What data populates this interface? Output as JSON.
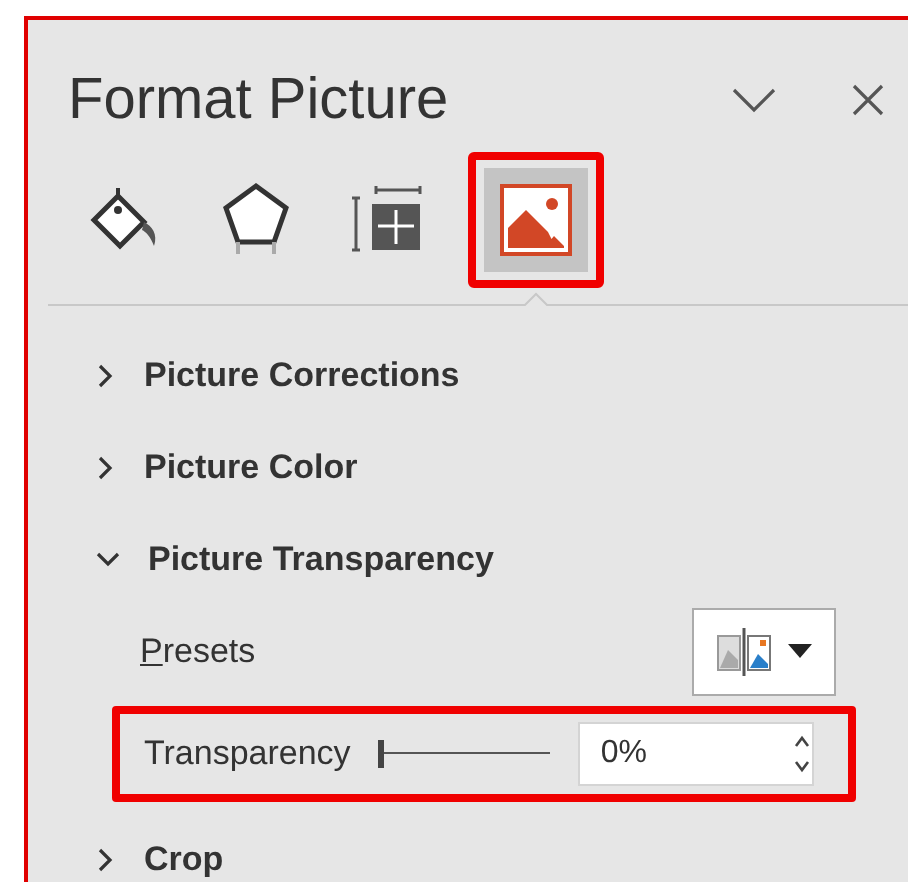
{
  "pane": {
    "title": "Format Picture",
    "highlighted": true
  },
  "tabs": [
    {
      "kind": "fill",
      "selected": false,
      "highlighted": false
    },
    {
      "kind": "shape",
      "selected": false,
      "highlighted": false
    },
    {
      "kind": "size",
      "selected": false,
      "highlighted": false
    },
    {
      "kind": "picture",
      "selected": true,
      "highlighted": true
    }
  ],
  "sections": [
    {
      "label": "Picture Corrections",
      "expanded": false
    },
    {
      "label": "Picture Color",
      "expanded": false
    },
    {
      "label": "Picture Transparency",
      "expanded": true,
      "presets": {
        "label": "Presets",
        "access_key_underlined": true
      },
      "transparency": {
        "label": "Transparency",
        "level": 0,
        "value": "0%",
        "highlighted": true
      }
    },
    {
      "label": "Crop",
      "expanded": false
    }
  ]
}
